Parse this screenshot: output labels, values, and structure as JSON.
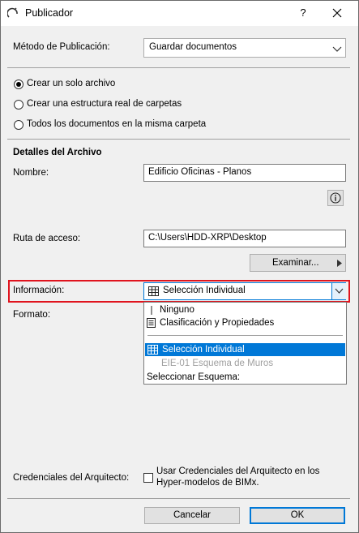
{
  "window": {
    "title": "Publicador",
    "help_label": "?"
  },
  "publish_method": {
    "label": "Método de Publicación:",
    "value": "Guardar documentos"
  },
  "structure_options": [
    {
      "label": "Crear un solo archivo",
      "selected": true
    },
    {
      "label": "Crear una estructura real de carpetas",
      "selected": false
    },
    {
      "label": "Todos los documentos en la misma carpeta",
      "selected": false
    }
  ],
  "file_details": {
    "heading": "Detalles del Archivo",
    "name_label": "Nombre:",
    "name_value": "Edificio Oficinas - Planos",
    "info_icon": "info-icon",
    "path_label": "Ruta de acceso:",
    "path_value": "C:\\Users\\HDD-XRP\\Desktop",
    "browse_label": "Examinar..."
  },
  "information": {
    "label": "Información:",
    "value": "Selección Individual",
    "options": [
      {
        "label": "Ninguno",
        "icon": "text-cursor-icon"
      },
      {
        "label": "Clasificación y Propiedades",
        "icon": "document-icon"
      },
      {
        "label": "Selección Individual",
        "icon": "table-icon",
        "selected": true
      },
      {
        "label": "EIE-01 Esquema de Muros",
        "disabled": true
      },
      {
        "label": "Seleccionar Esquema:"
      }
    ]
  },
  "format": {
    "label": "Formato:"
  },
  "credentials": {
    "label": "Credenciales del Arquitecto:",
    "checkbox_line1": "Usar Credenciales del Arquitecto en los",
    "checkbox_line2": "Hyper-modelos de BIMx.",
    "checked": false
  },
  "footer": {
    "cancel_label": "Cancelar",
    "ok_label": "OK"
  },
  "colors": {
    "highlight_border": "#e0141e",
    "selection_bg": "#0078d7",
    "ok_border": "#0078d7"
  }
}
